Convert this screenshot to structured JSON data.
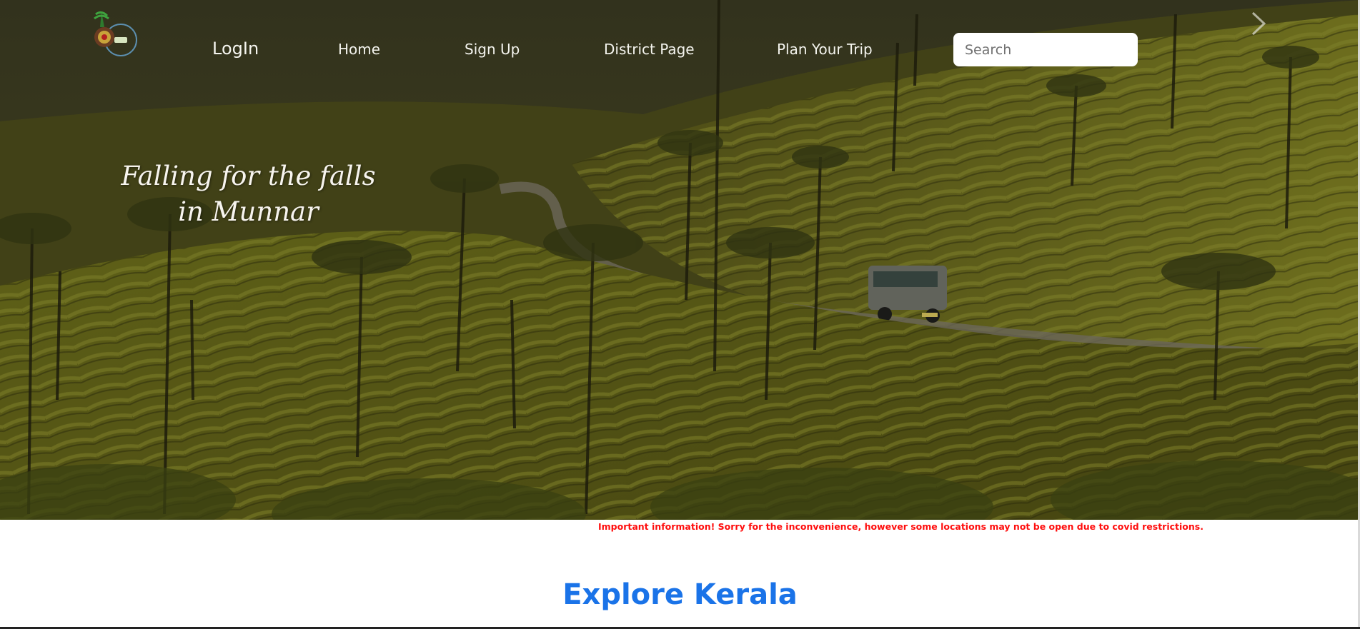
{
  "nav": {
    "login": "LogIn",
    "home": "Home",
    "signup": "Sign Up",
    "district": "District Page",
    "plan_trip": "Plan Your Trip"
  },
  "search": {
    "placeholder": "Search"
  },
  "hero": {
    "caption_line1": "Falling for the falls",
    "caption_line2": "in Munnar"
  },
  "notice": "Important information! Sorry for the inconvenience, however some locations may not be open due to covid restrictions.",
  "section": {
    "title": "Explore Kerala"
  },
  "icons": {
    "logo": "kerala-tourism-logo-icon",
    "next": "chevron-right-icon"
  },
  "colors": {
    "accent": "#1a73e8",
    "notice": "#ff0d0d",
    "nav_text": "#f4f4ee"
  }
}
